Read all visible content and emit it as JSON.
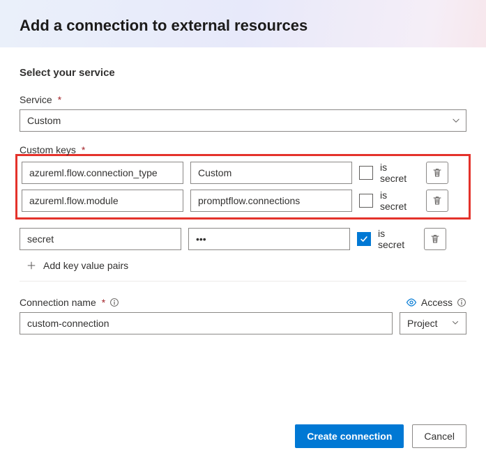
{
  "header": {
    "title": "Add a connection to external resources"
  },
  "section": {
    "heading": "Select your service"
  },
  "service": {
    "label": "Service",
    "required_marker": "*",
    "selected": "Custom"
  },
  "custom_keys": {
    "label": "Custom keys",
    "required_marker": "*",
    "rows": [
      {
        "key": "azureml.flow.connection_type",
        "value": "Custom",
        "is_secret": false
      },
      {
        "key": "azureml.flow.module",
        "value": "promptflow.connections",
        "is_secret": false
      },
      {
        "key": "secret",
        "value": "•••",
        "is_secret": true
      }
    ],
    "is_secret_label": "is secret",
    "add_label": "Add key value pairs"
  },
  "connection_name": {
    "label": "Connection name",
    "required_marker": "*",
    "value": "custom-connection"
  },
  "access": {
    "label": "Access",
    "selected": "Project"
  },
  "footer": {
    "primary": "Create connection",
    "secondary": "Cancel"
  }
}
